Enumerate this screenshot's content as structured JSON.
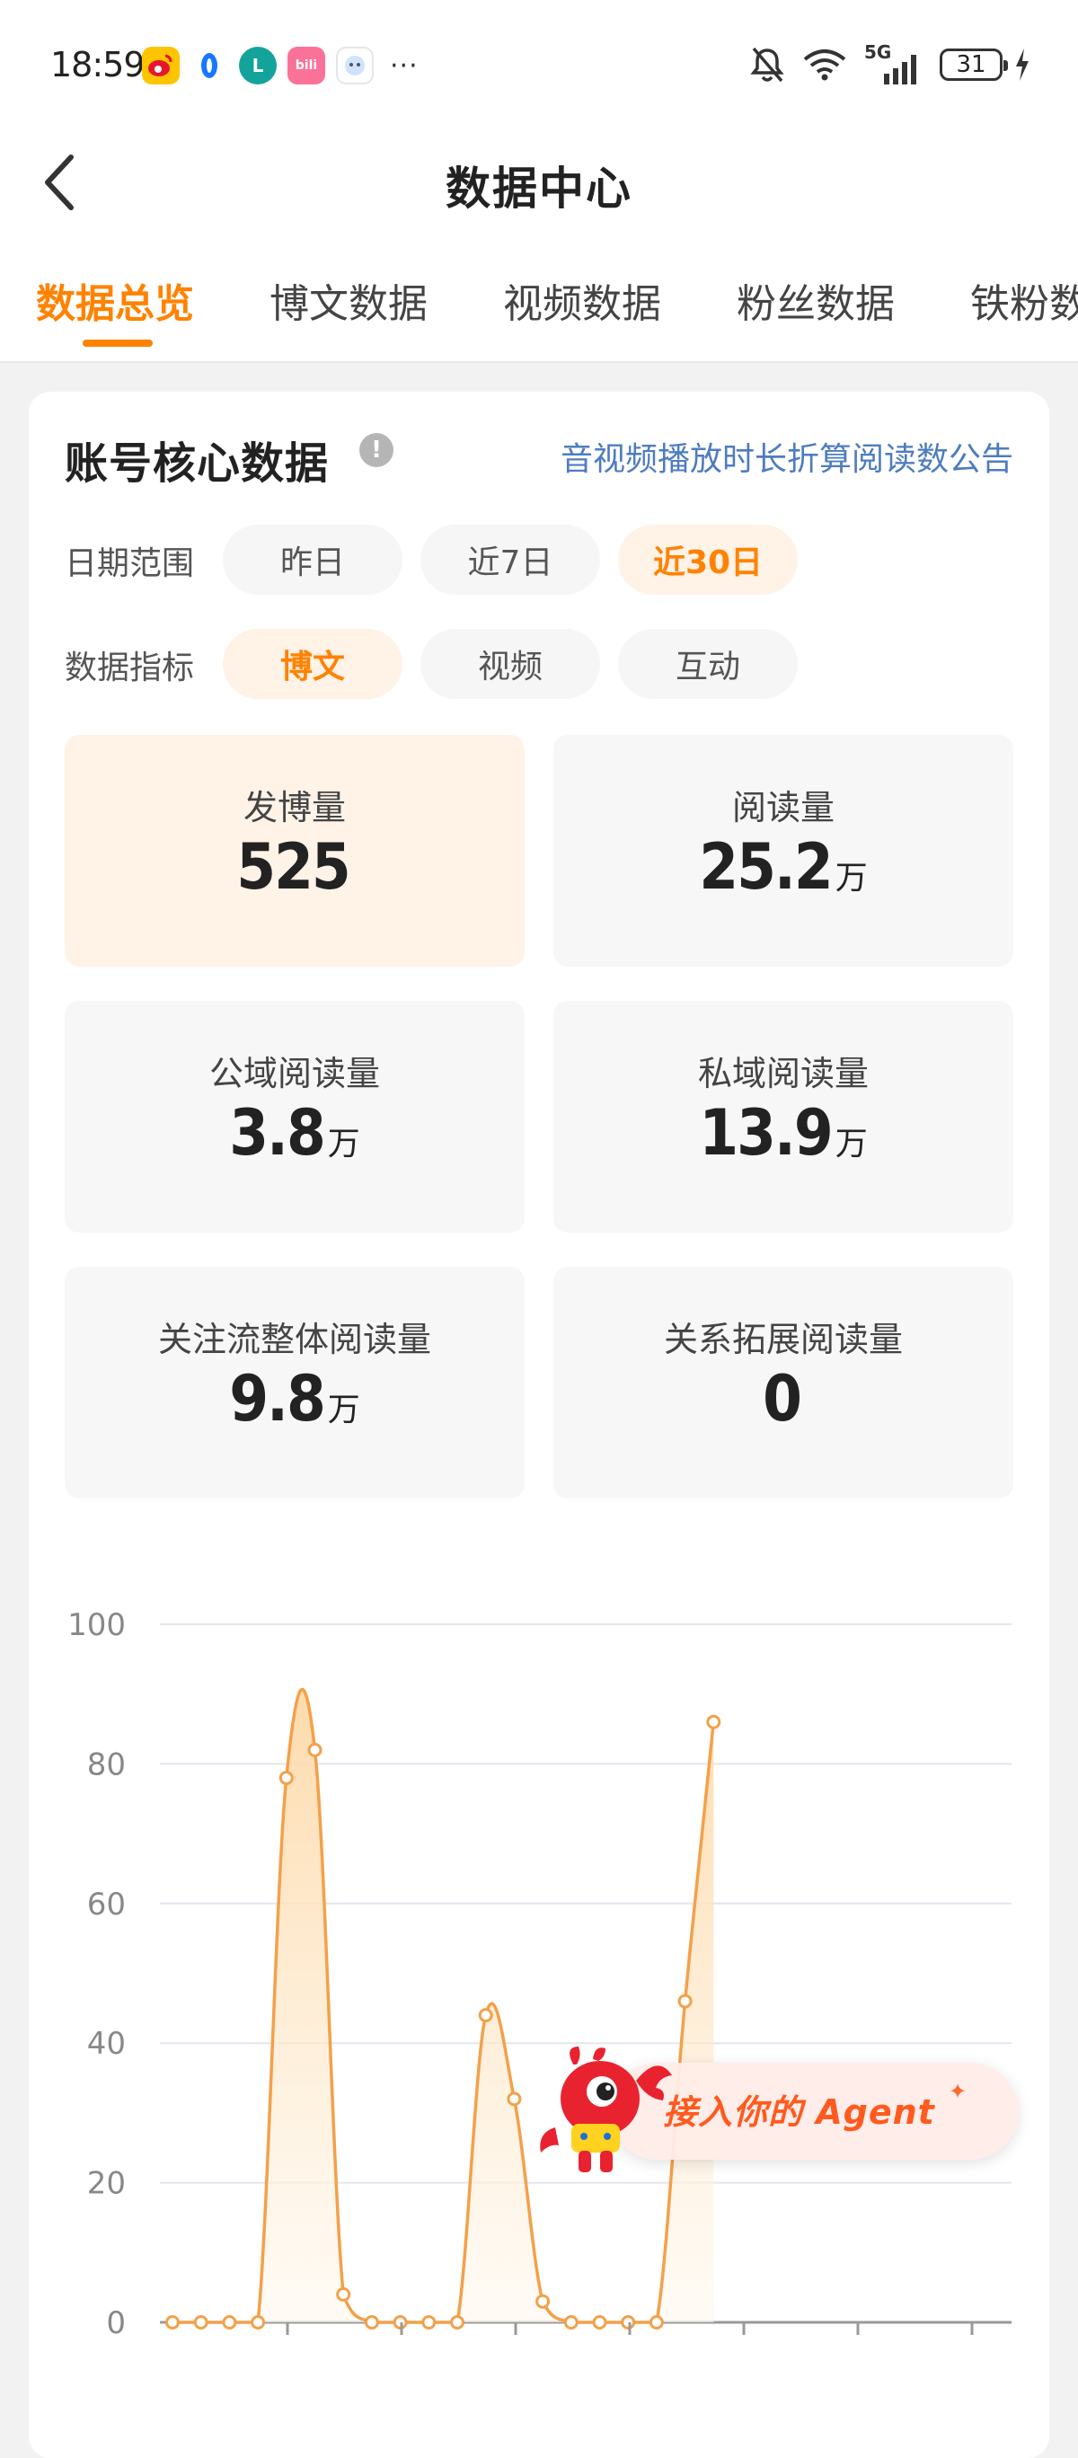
{
  "status_bar": {
    "time": "18:59",
    "signal_label": "5G",
    "battery_level": "31",
    "more_dots": "···"
  },
  "header": {
    "title": "数据中心"
  },
  "tabs": [
    {
      "label": "数据总览",
      "active": true
    },
    {
      "label": "博文数据",
      "active": false
    },
    {
      "label": "视频数据",
      "active": false
    },
    {
      "label": "粉丝数据",
      "active": false
    },
    {
      "label": "铁粉数据",
      "active": false
    }
  ],
  "core_data": {
    "title": "账号核心数据",
    "info_icon": "!",
    "notice_link": "音视频播放时长折算阅读数公告",
    "date_range": {
      "label": "日期范围",
      "options": [
        "昨日",
        "近7日",
        "近30日"
      ],
      "selected": "近30日"
    },
    "metric_type": {
      "label": "数据指标",
      "options": [
        "博文",
        "视频",
        "互动"
      ],
      "selected": "博文"
    },
    "metrics": [
      {
        "label": "发博量",
        "value": "525",
        "unit": "",
        "highlighted": true
      },
      {
        "label": "阅读量",
        "value": "25.2",
        "unit": "万",
        "highlighted": false
      },
      {
        "label": "公域阅读量",
        "value": "3.8",
        "unit": "万",
        "highlighted": false
      },
      {
        "label": "私域阅读量",
        "value": "13.9",
        "unit": "万",
        "highlighted": false
      },
      {
        "label": "关注流整体阅读量",
        "value": "9.8",
        "unit": "万",
        "highlighted": false
      },
      {
        "label": "关系拓展阅读量",
        "value": "0",
        "unit": "",
        "highlighted": false
      }
    ]
  },
  "chart_data": {
    "type": "area",
    "title": "",
    "xlabel": "",
    "ylabel": "",
    "ylim": [
      0,
      100
    ],
    "yticks": [
      0,
      20,
      40,
      60,
      80,
      100
    ],
    "grid": true,
    "x": [
      1,
      2,
      3,
      4,
      5,
      6,
      7,
      8,
      9,
      10,
      11,
      12,
      13,
      14,
      15,
      16,
      17,
      18,
      19,
      20
    ],
    "series": [
      {
        "values": [
          0,
          0,
          0,
          0,
          78,
          82,
          4,
          0,
          0,
          0,
          0,
          44,
          32,
          3,
          0,
          0,
          0,
          0,
          46,
          86
        ]
      }
    ],
    "colors": {
      "line": "#f4a04a",
      "fill_top": "#fdd9a8",
      "fill_bottom": "#fff8ee"
    }
  },
  "agent_badge": {
    "text": "接入你的 Agent",
    "sparkle": "✦"
  }
}
